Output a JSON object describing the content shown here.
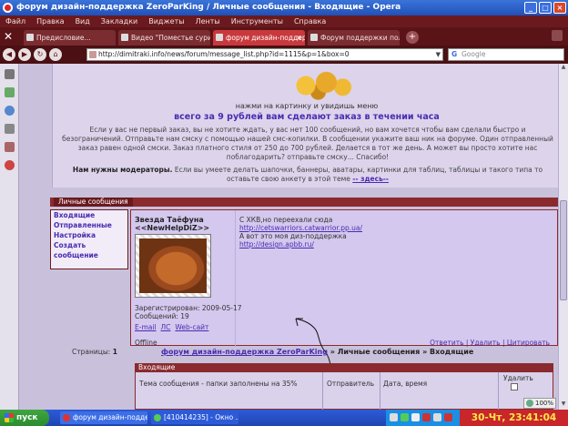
{
  "window": {
    "title": "форум дизайн-поддержка ZeroParKing / Личные сообщения - Входящие - Opera"
  },
  "menu": [
    "Файл",
    "Правка",
    "Вид",
    "Закладки",
    "Виджеты",
    "Ленты",
    "Инструменты",
    "Справка"
  ],
  "tabs": [
    {
      "label": "Предисловие..."
    },
    {
      "label": "Видео \"Поместье сури..."
    },
    {
      "label": "форум дизайн-поддерж..."
    },
    {
      "label": "Форум поддержки пол..."
    }
  ],
  "address": {
    "url": "http://dimitraki.info/news/forum/message_list.php?id=1115&p=1&box=0"
  },
  "search": {
    "placeholder": "Google"
  },
  "promo": {
    "line1": "нажми на картинку и увидишь меню",
    "line2": "всего за 9 рублей вам сделают заказ в течении часа",
    "para": "Если у вас не первый заказ, вы не хотите ждать, у вас нет 100 сообщений, но вам хочется чтобы вам сделали быстро и безограничений. Отправьте нам смску с помощью нашей смс-копилки. В сообщении укажите ваш ник на форуме. Один отправленный заказ равен одной смски. Заказ платного стиля от 250 до 700 рублей. Делается в тот же день. А может вы просто хотите нас поблагодарить? отправьте смску... Спасибо!",
    "mods_bold": "Нам нужны модераторы.",
    "mods_text": " Если вы умеете делать шапочки, баннеры, аватары, картинки для таблиц, таблицы и такого типа то оставьте свою анкету в этой теме ",
    "mods_link": "-- здесь--"
  },
  "pm": {
    "header": "Личные сообщения",
    "menu": [
      "Входящие",
      "Отправленные",
      "Настройка",
      "Создать сообщение"
    ]
  },
  "post": {
    "author": "Звезда Таёфуна",
    "rank": "<<NewHelpDiZ>>",
    "registered": "Зарегистрирован: 2009-05-17",
    "messages": "Сообщений: 19",
    "links": [
      "E-mail",
      "ЛС",
      "Web-сайт"
    ],
    "status": "Offline",
    "body_line1": "С ХКВ,но переехали сюда",
    "body_link1": "http://cetswarriors.catwarrior.pp.ua/",
    "body_line2": "А вот это моя диз-поддержка",
    "body_link2": "http://design.apbb.ru/",
    "actions": "Ответить | Удалить | Цитировать"
  },
  "pages": {
    "label": "Страницы:",
    "value": "1"
  },
  "breadcrumb": {
    "forum": "форум дизайн-поддержка ZeroParKing",
    "rest": " » Личные сообщения » Входящие"
  },
  "inbox": {
    "header": "Входящие",
    "col1": "Тема сообщения - папки заполнены на 35%",
    "col2": "Отправитель",
    "col3": "Дата, время",
    "col4": "Удалить"
  },
  "zoom": "100%",
  "taskbar": {
    "start": "пуск",
    "items": [
      "форум дизайн-поддерж...",
      "[410414235] - Окно ..."
    ],
    "clock": "30-Чт, 23:41:04"
  }
}
